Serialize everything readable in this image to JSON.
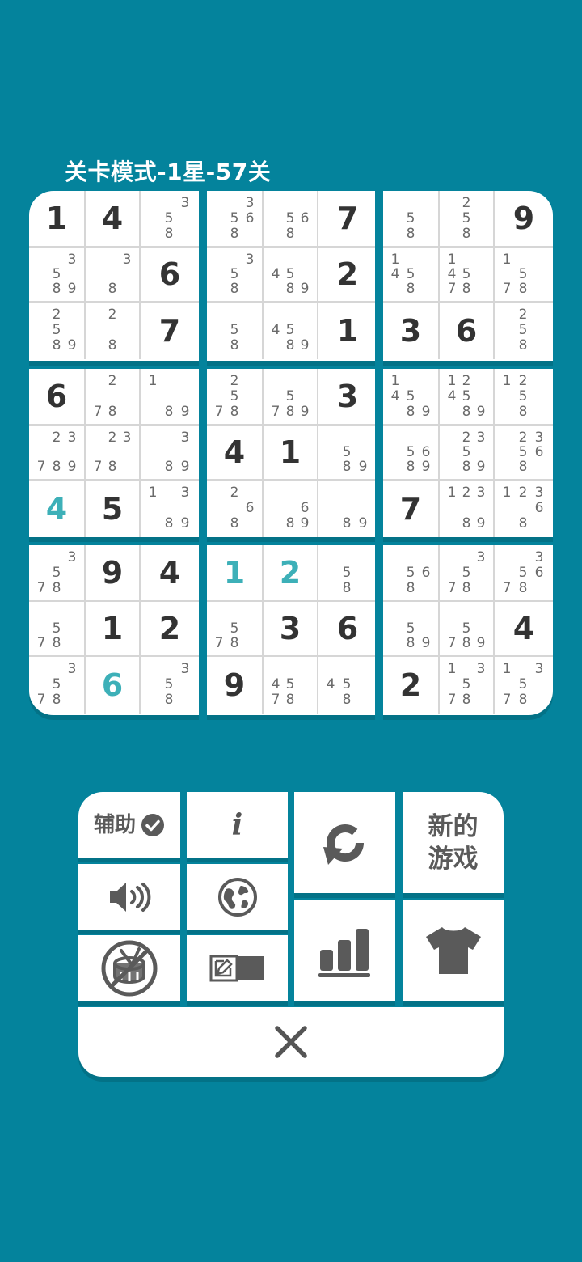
{
  "title": "关卡模式-1星-57关",
  "colors": {
    "background": "#04839c",
    "cell_bg": "#ffffff",
    "given_digit": "#333333",
    "user_digit": "#3db0b8",
    "note": "#6a6a6a"
  },
  "board": [
    [
      {
        "v": "1"
      },
      {
        "v": "4"
      },
      {
        "n": [
          3,
          5,
          8
        ]
      },
      {
        "n": [
          3,
          5,
          6,
          8
        ]
      },
      {
        "n": [
          5,
          6,
          8
        ]
      },
      {
        "v": "7"
      },
      {
        "n": [
          5,
          8
        ]
      },
      {
        "n": [
          2,
          5,
          8
        ]
      },
      {
        "v": "9"
      }
    ],
    [
      {
        "n": [
          3,
          5,
          8,
          9
        ]
      },
      {
        "n": [
          3,
          8
        ]
      },
      {
        "v": "6"
      },
      {
        "n": [
          3,
          5,
          8
        ]
      },
      {
        "n": [
          4,
          5,
          8,
          9
        ]
      },
      {
        "v": "2"
      },
      {
        "n": [
          1,
          4,
          5,
          8
        ]
      },
      {
        "n": [
          1,
          4,
          5,
          7,
          8
        ]
      },
      {
        "n": [
          1,
          5,
          7,
          8
        ]
      }
    ],
    [
      {
        "n": [
          2,
          5,
          8,
          9
        ]
      },
      {
        "n": [
          2,
          8
        ]
      },
      {
        "v": "7"
      },
      {
        "n": [
          5,
          8
        ]
      },
      {
        "n": [
          4,
          5,
          8,
          9
        ]
      },
      {
        "v": "1"
      },
      {
        "v": "3"
      },
      {
        "v": "6"
      },
      {
        "n": [
          2,
          5,
          8
        ]
      }
    ],
    [
      {
        "v": "6"
      },
      {
        "n": [
          2,
          7,
          8
        ]
      },
      {
        "n": [
          1,
          8,
          9
        ]
      },
      {
        "n": [
          2,
          5,
          7,
          8
        ]
      },
      {
        "n": [
          5,
          7,
          8,
          9
        ]
      },
      {
        "v": "3"
      },
      {
        "n": [
          1,
          4,
          5,
          8,
          9
        ]
      },
      {
        "n": [
          1,
          2,
          4,
          5,
          8,
          9
        ]
      },
      {
        "n": [
          1,
          2,
          5,
          8
        ]
      }
    ],
    [
      {
        "n": [
          2,
          3,
          7,
          8,
          9
        ]
      },
      {
        "n": [
          2,
          3,
          7,
          8
        ]
      },
      {
        "n": [
          3,
          8,
          9
        ]
      },
      {
        "v": "4"
      },
      {
        "v": "1"
      },
      {
        "n": [
          5,
          8,
          9
        ]
      },
      {
        "n": [
          5,
          6,
          8,
          9
        ]
      },
      {
        "n": [
          2,
          3,
          5,
          8,
          9
        ]
      },
      {
        "n": [
          2,
          3,
          5,
          6,
          8
        ]
      }
    ],
    [
      {
        "v": "4",
        "u": true
      },
      {
        "v": "5"
      },
      {
        "n": [
          1,
          3,
          8,
          9
        ]
      },
      {
        "n": [
          2,
          6,
          8
        ]
      },
      {
        "n": [
          6,
          8,
          9
        ]
      },
      {
        "n": [
          8,
          9
        ]
      },
      {
        "v": "7"
      },
      {
        "n": [
          1,
          2,
          3,
          8,
          9
        ]
      },
      {
        "n": [
          1,
          2,
          3,
          6,
          8
        ]
      }
    ],
    [
      {
        "n": [
          3,
          5,
          7,
          8
        ]
      },
      {
        "v": "9"
      },
      {
        "v": "4"
      },
      {
        "v": "1",
        "u": true
      },
      {
        "v": "2",
        "u": true
      },
      {
        "n": [
          5,
          8
        ]
      },
      {
        "n": [
          5,
          6,
          8
        ]
      },
      {
        "n": [
          3,
          5,
          7,
          8
        ]
      },
      {
        "n": [
          3,
          5,
          6,
          7,
          8
        ]
      }
    ],
    [
      {
        "n": [
          5,
          7,
          8
        ]
      },
      {
        "v": "1"
      },
      {
        "v": "2"
      },
      {
        "n": [
          5,
          7,
          8
        ]
      },
      {
        "v": "3"
      },
      {
        "v": "6"
      },
      {
        "n": [
          5,
          8,
          9
        ]
      },
      {
        "n": [
          5,
          7,
          8,
          9
        ]
      },
      {
        "v": "4"
      }
    ],
    [
      {
        "n": [
          3,
          5,
          7,
          8
        ]
      },
      {
        "v": "6",
        "u": true
      },
      {
        "n": [
          3,
          5,
          8
        ]
      },
      {
        "v": "9"
      },
      {
        "n": [
          4,
          5,
          7,
          8
        ]
      },
      {
        "n": [
          4,
          5,
          8
        ]
      },
      {
        "v": "2"
      },
      {
        "n": [
          1,
          3,
          5,
          7,
          8
        ]
      },
      {
        "n": [
          1,
          3,
          5,
          7,
          8
        ]
      }
    ]
  ],
  "menu": {
    "assist_label": "辅助",
    "new_game_line1": "新的",
    "new_game_line2": "游戏",
    "info_label": "i",
    "icons": {
      "assist": "check-circle-icon",
      "info": "info-icon",
      "restart": "restart-icon",
      "sound": "speaker-icon",
      "language": "globe-icon",
      "no_ads": "no-ads-drum-icon",
      "notes_mode": "notes-toggle-icon",
      "stats": "bar-chart-icon",
      "theme": "tshirt-icon",
      "close": "close-icon"
    }
  }
}
